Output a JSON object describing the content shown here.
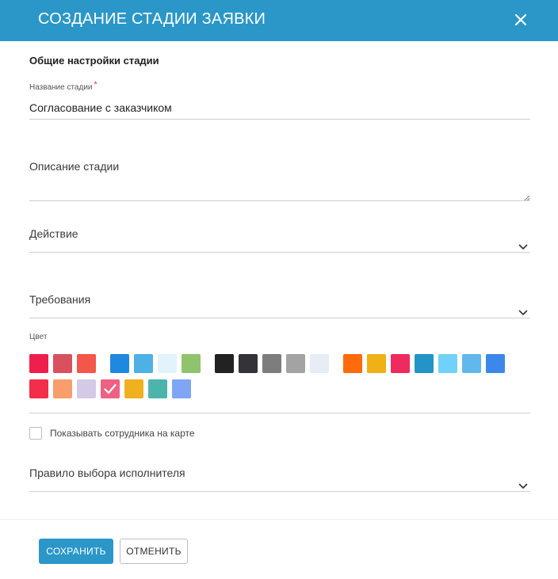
{
  "header": {
    "title": "СОЗДАНИЕ СТАДИИ ЗАЯВКИ",
    "close_icon": "close-icon"
  },
  "form": {
    "section_title": "Общие настройки стадии",
    "stage_name": {
      "label": "Название стадии",
      "required_mark": "*",
      "value": "Согласование с заказчиком"
    },
    "description": {
      "placeholder": "Описание стадии"
    },
    "action": {
      "placeholder": "Действие",
      "icon": "chevron-down-icon"
    },
    "requirements": {
      "placeholder": "Требования",
      "icon": "chevron-down-icon"
    },
    "color": {
      "label": "Цвет",
      "selected_index": 22,
      "swatches": [
        "#ee1f4d",
        "#d9505e",
        "#f2574a",
        "#1f88e0",
        "#4db1e6",
        "#e2f3fc",
        "#8fc46c",
        "#222222",
        "#333338",
        "#7d7d7d",
        "#a3a3a3",
        "#e6edf4",
        "#ff6b0a",
        "#efb115",
        "#ef2a5f",
        "#2294c8",
        "#70d2fb",
        "#61b8ec",
        "#3b88ea",
        "#f22e4b",
        "#f99d6c",
        "#d4cae5",
        "#ee6182",
        "#efb11e",
        "#4cb5ab",
        "#7ea6f5"
      ]
    },
    "show_employee": {
      "label": "Показывать сотрудника на карте",
      "checked": false
    },
    "executor_rule": {
      "placeholder": "Правило выбора исполнителя",
      "icon": "chevron-down-icon"
    }
  },
  "footer": {
    "save_label": "СОХРАНИТЬ",
    "cancel_label": "ОТМЕНИТЬ"
  }
}
